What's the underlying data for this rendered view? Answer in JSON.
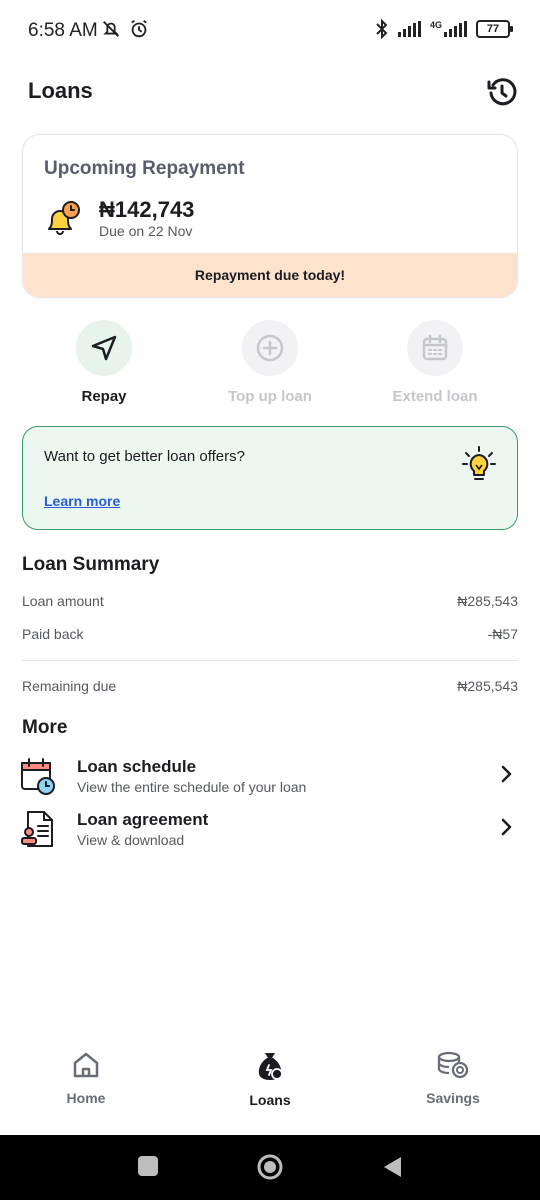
{
  "status_bar": {
    "time": "6:58 AM",
    "network": "4G",
    "battery": "77"
  },
  "header": {
    "title": "Loans"
  },
  "upcoming": {
    "title": "Upcoming Repayment",
    "amount": "₦142,743",
    "due": "Due on 22 Nov",
    "banner": "Repayment due today!"
  },
  "actions": [
    {
      "label": "Repay",
      "enabled": true
    },
    {
      "label": "Top up loan",
      "enabled": false
    },
    {
      "label": "Extend loan",
      "enabled": false
    }
  ],
  "offer": {
    "text": "Want to get better loan offers?",
    "link": "Learn more"
  },
  "summary": {
    "title": "Loan Summary",
    "rows": [
      {
        "label": "Loan amount",
        "value": "₦285,543"
      },
      {
        "label": "Paid back",
        "value": "-₦57"
      },
      {
        "label": "Remaining due",
        "value": "₦285,543"
      }
    ]
  },
  "more": {
    "title": "More",
    "items": [
      {
        "title": "Loan schedule",
        "subtitle": "View the entire schedule of your loan"
      },
      {
        "title": "Loan agreement",
        "subtitle": "View & download"
      }
    ]
  },
  "nav": {
    "items": [
      {
        "label": "Home"
      },
      {
        "label": "Loans"
      },
      {
        "label": "Savings"
      }
    ],
    "active": "Loans"
  },
  "colors": {
    "accent_green": "#3a9a6c",
    "banner_peach": "#fde3cd",
    "link_blue": "#2a5bd7",
    "offer_bg": "#ecf7f0"
  }
}
